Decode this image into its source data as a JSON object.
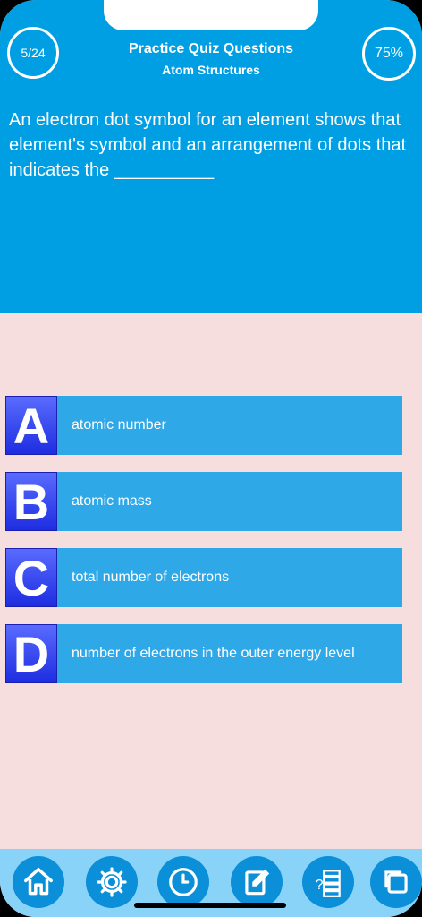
{
  "header": {
    "progress": "5/24",
    "score": "75%",
    "title": "Practice Quiz Questions",
    "subtitle": "Atom Structures"
  },
  "question": {
    "text": "An electron dot symbol for an element shows that element's symbol and an arrangement of dots that indicates the __________"
  },
  "options": [
    {
      "letter": "A",
      "text": "atomic number"
    },
    {
      "letter": "B",
      "text": "atomic mass"
    },
    {
      "letter": "C",
      "text": "total number of electrons"
    },
    {
      "letter": "D",
      "text": "number of electrons in the outer energy level"
    }
  ],
  "nav": {
    "icons": [
      "home-icon",
      "gear-icon",
      "clock-icon",
      "edit-icon",
      "answers-list-icon",
      "copy-icon"
    ]
  },
  "colors": {
    "header_bg": "#009fe3",
    "body_bg": "#f6dede",
    "option_bg": "#2fa8e8",
    "letter_bg": "#1d2ce0",
    "nav_bg": "#8ad3f8",
    "nav_button": "#0b8fd8"
  }
}
